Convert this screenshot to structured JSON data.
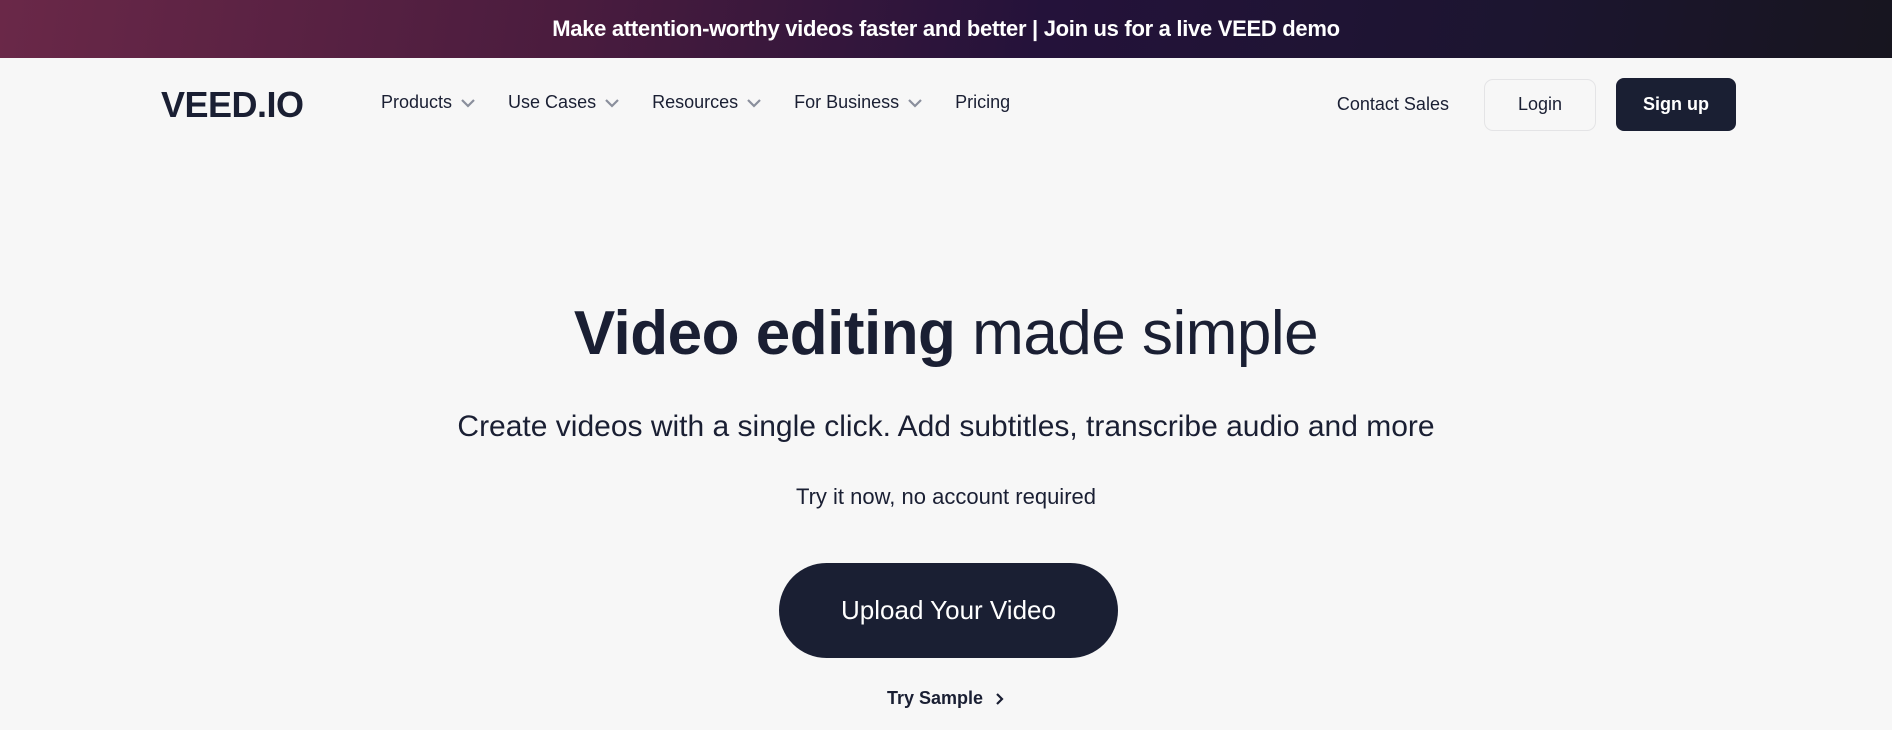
{
  "promo_banner": {
    "text": "Make attention-worthy videos faster and better | Join us for a live VEED demo"
  },
  "header": {
    "logo": "VEED.IO",
    "menu": [
      {
        "label": "Products",
        "has_dropdown": true
      },
      {
        "label": "Use Cases",
        "has_dropdown": true
      },
      {
        "label": "Resources",
        "has_dropdown": true
      },
      {
        "label": "For Business",
        "has_dropdown": true
      },
      {
        "label": "Pricing",
        "has_dropdown": false
      }
    ],
    "contact_sales": "Contact Sales",
    "login": "Login",
    "signup": "Sign up"
  },
  "hero": {
    "headline_bold": "Video editing",
    "headline_light": "made simple",
    "subtitle": "Create videos with a single click. Add subtitles, transcribe audio and more",
    "note": "Try it now, no account required",
    "upload_button": "Upload Your Video",
    "try_sample": "Try Sample",
    "try_sample_icon": "chevron-right-icon"
  },
  "colors": {
    "primary": "#1a1f33",
    "background": "#f7f7f7",
    "banner_gradient_start": "#6a2848",
    "banner_gradient_end": "#17151f"
  }
}
